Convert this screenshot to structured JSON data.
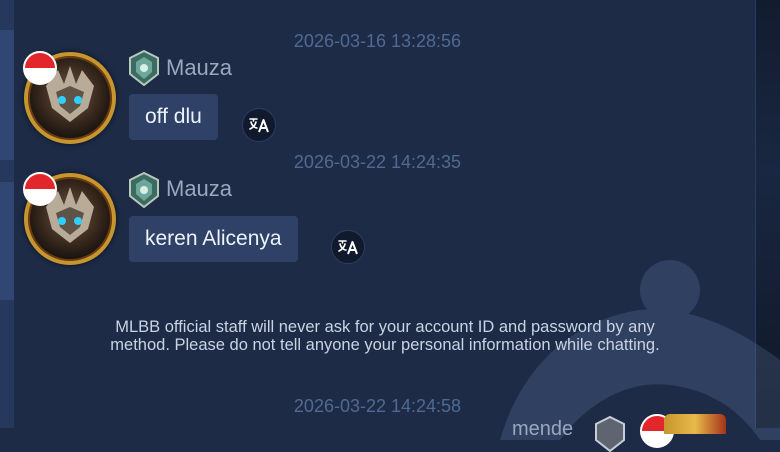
{
  "messages": [
    {
      "timestamp": "2026-03-16 13:28:56",
      "username": "Mauza",
      "text": "off dlu"
    },
    {
      "timestamp": "2026-03-22 14:24:35",
      "username": "Mauza",
      "text": "keren Alicenya"
    }
  ],
  "notice": {
    "line1": "MLBB official staff will never ask for your account ID and password by any",
    "line2": "method. Please do not tell anyone your personal information while chatting."
  },
  "last_timestamp": "2026-03-22 14:24:58",
  "bottom_partial_username": "mende",
  "colors": {
    "background": "#1d2b47",
    "bubble": "#2f4166",
    "timestamp": "#4f6a92",
    "username": "#9aa8bd",
    "avatar_frame": "#c7952e",
    "flag_red": "#e3262c"
  },
  "icons": {
    "flag": "indonesia-flag-icon",
    "rank": "rank-badge-icon",
    "translate": "translate-icon"
  }
}
